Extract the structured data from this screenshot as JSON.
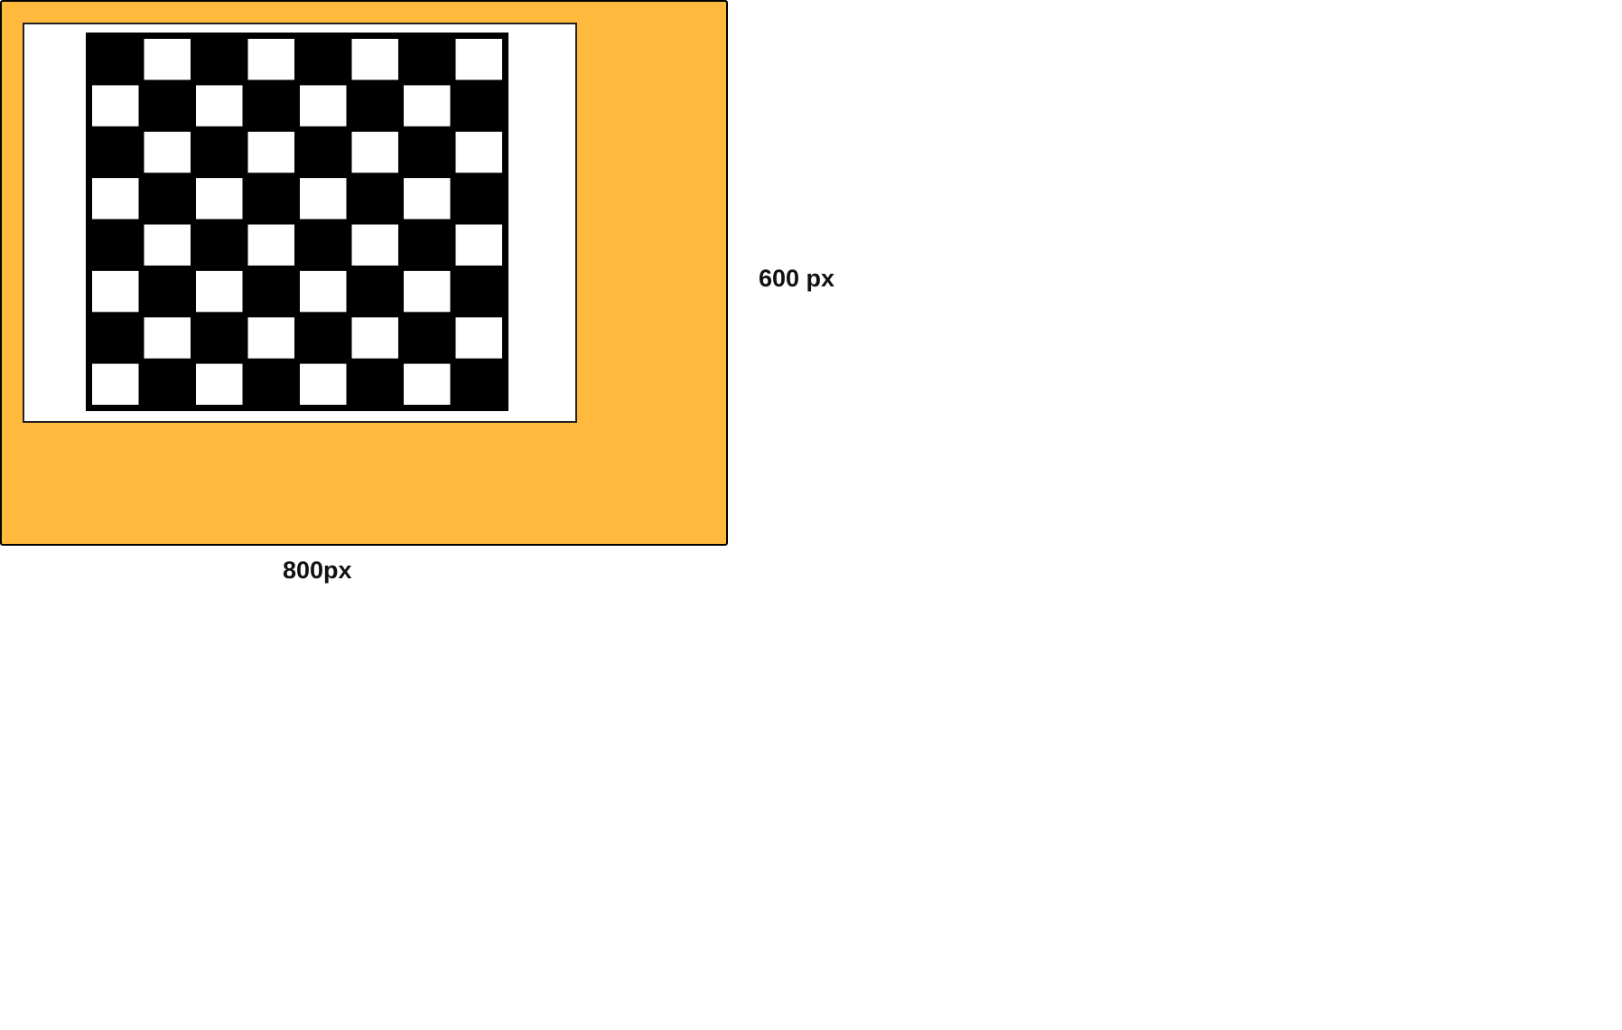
{
  "diagram": {
    "outer_color": "#FFBA3D",
    "panel_color": "#FFFFFF",
    "board": {
      "rows": 8,
      "cols": 8,
      "dark_color": "#000000",
      "light_color": "#FFFFFF",
      "first_cell_dark": true
    },
    "height_label": "600 px",
    "width_label": "800px"
  }
}
